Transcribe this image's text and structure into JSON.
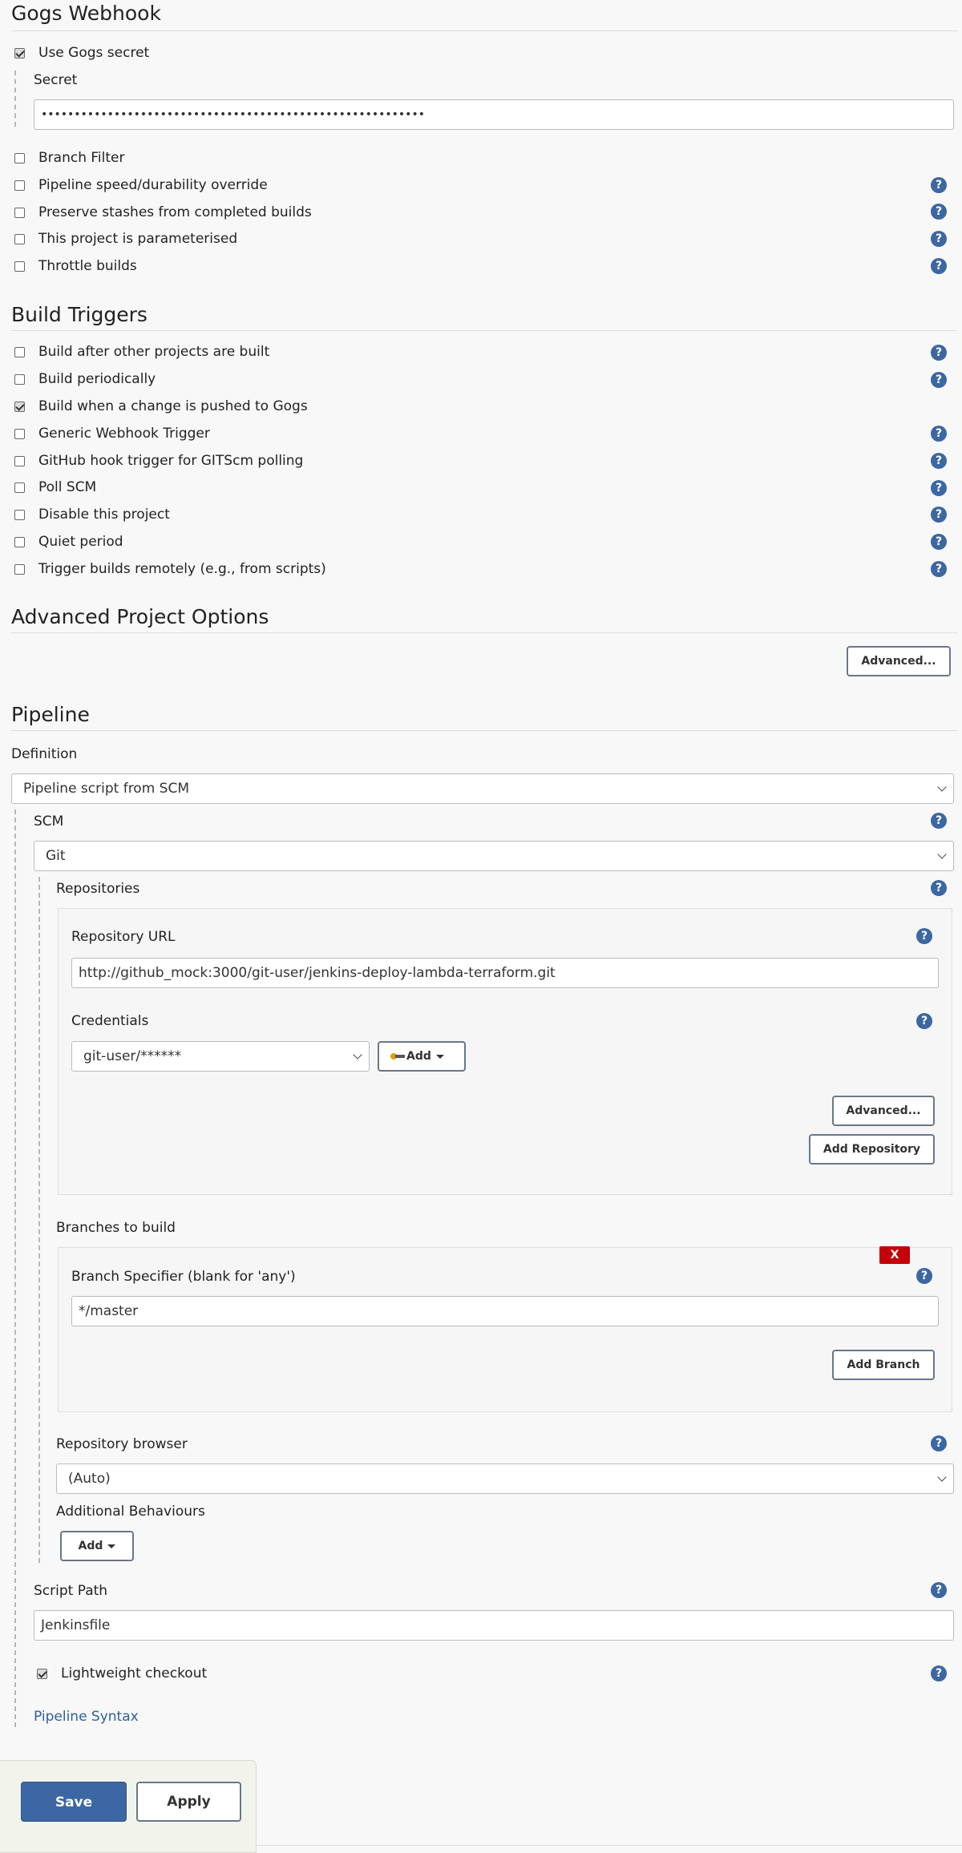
{
  "gogs_webhook": {
    "title": "Gogs Webhook",
    "use_secret_label": "Use Gogs secret",
    "use_secret_checked": true,
    "secret_label": "Secret",
    "secret_value": "••••••••••••••••••••••••••••••••••••••••••••••••••••••••••",
    "options": [
      {
        "label": "Branch Filter",
        "checked": false,
        "help": false
      },
      {
        "label": "Pipeline speed/durability override",
        "checked": false,
        "help": true
      },
      {
        "label": "Preserve stashes from completed builds",
        "checked": false,
        "help": true
      },
      {
        "label": "This project is parameterised",
        "checked": false,
        "help": true
      },
      {
        "label": "Throttle builds",
        "checked": false,
        "help": true
      }
    ]
  },
  "build_triggers": {
    "title": "Build Triggers",
    "options": [
      {
        "label": "Build after other projects are built",
        "checked": false,
        "help": true
      },
      {
        "label": "Build periodically",
        "checked": false,
        "help": true
      },
      {
        "label": "Build when a change is pushed to Gogs",
        "checked": true,
        "help": false
      },
      {
        "label": "Generic Webhook Trigger",
        "checked": false,
        "help": true
      },
      {
        "label": "GitHub hook trigger for GITScm polling",
        "checked": false,
        "help": true
      },
      {
        "label": "Poll SCM",
        "checked": false,
        "help": true
      },
      {
        "label": "Disable this project",
        "checked": false,
        "help": true
      },
      {
        "label": "Quiet period",
        "checked": false,
        "help": true
      },
      {
        "label": "Trigger builds remotely (e.g., from scripts)",
        "checked": false,
        "help": true
      }
    ]
  },
  "advanced_project_options": {
    "title": "Advanced Project Options",
    "advanced_button": "Advanced..."
  },
  "pipeline": {
    "title": "Pipeline",
    "definition_label": "Definition",
    "definition_value": "Pipeline script from SCM",
    "scm_label": "SCM",
    "scm_value": "Git",
    "repositories_label": "Repositories",
    "repository_url_label": "Repository URL",
    "repository_url_value": "http://github_mock:3000/git-user/jenkins-deploy-lambda-terraform.git",
    "credentials_label": "Credentials",
    "credentials_value": "git-user/******",
    "add_credentials_button": "Add",
    "repo_advanced_button": "Advanced...",
    "add_repository_button": "Add Repository",
    "branches_label": "Branches to build",
    "remove_branch_button": "X",
    "branch_specifier_label": "Branch Specifier (blank for 'any')",
    "branch_specifier_value": "*/master",
    "add_branch_button": "Add Branch",
    "repository_browser_label": "Repository browser",
    "repository_browser_value": "(Auto)",
    "additional_behaviours_label": "Additional Behaviours",
    "add_behaviour_button": "Add",
    "script_path_label": "Script Path",
    "script_path_value": "Jenkinsfile",
    "lightweight_checkout_label": "Lightweight checkout",
    "lightweight_checkout_checked": true,
    "pipeline_syntax_link": "Pipeline Syntax"
  },
  "footer": {
    "save_button": "Save",
    "apply_button": "Apply"
  },
  "colors": {
    "accent": "#3c67a2",
    "danger": "#c4000a",
    "link": "#2e5f9e"
  }
}
